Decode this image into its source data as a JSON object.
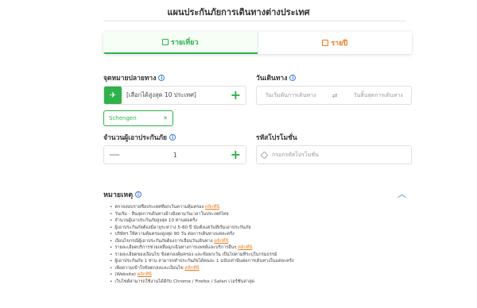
{
  "page": {
    "title": "แผนประกันภัยการเดินทางต่างประเทศ"
  },
  "tabs": [
    {
      "label": "รายเที่ยว"
    },
    {
      "label": "รายปี"
    }
  ],
  "destination": {
    "label": "จุดหมายปลายทาง",
    "placeholder": "[เลือกได้สูงสุด 10 ประเทศ]",
    "chip": "Schengen"
  },
  "travel_dates": {
    "label": "วันเดินทาง",
    "start_placeholder": "วันเริ่มต้นการเดินทาง",
    "end_placeholder": "วันสิ้นสุดการเดินทาง"
  },
  "travelers": {
    "label": "จำนวนผู้เอาประกันภัย",
    "value": "1"
  },
  "promo": {
    "label": "รหัสโปรโมชั่น",
    "placeholder": "กรอกรหัสโปรโมชั่น"
  },
  "remarks": {
    "label": "หมายเหตุ",
    "link_text": "คลิกที่นี่",
    "notes": [
      {
        "text": "ตรวจสอบรายชื่อประเทศที่ยกเว้นความคุ้มครอง ",
        "link": true
      },
      {
        "text": "วันเริ่ม - สิ้นสุดการเดินทางอ้างอิงตามวันเวลาในประเทศไทย",
        "link": false
      },
      {
        "text": "จำนวนผู้เอาประกันภัยสูงสุด 10 ท่านต่อครั้ง",
        "link": false
      },
      {
        "text": "ผู้เอาประกันภัยต้องมีอายุระหว่าง 5-80 ปี นับตั้งแต่วันที่เริ่มเอาประกันภัย",
        "link": false
      },
      {
        "text": "บริษัทฯ ให้ความคุ้มครองสูงสุด 90 วัน ต่อการเดินทางแต่ละครั้ง",
        "link": false
      },
      {
        "text": "เงื่อนไขกรณีผู้เอาประกันภัยต้องการเลื่อนวันเดินทาง ",
        "link": true
      },
      {
        "text": "รายละเอียดบริการช่วยเหลือฉุกเฉินทางการแพทย์และบริการอื่นๆ ",
        "link": true
      },
      {
        "text": "รายละเอียดของเงื่อนไข ข้อตกลงคุ้มครอง และข้อยกเว้น เป็นไปตามที่ระบุในกรมธรรม์",
        "link": false
      },
      {
        "text": "ผู้เอาประกันภัย 1 ท่าน สามารถทำประกันภัยได้คนละ 1 ฉบับเท่านั้นต่อการเดินทางในแต่ละครั้ง",
        "link": false
      },
      {
        "text": "เพื่อความเข้าใจข้อตกลงและเงื่อนไข ",
        "link": true
      },
      {
        "text": "(Website) ",
        "link": true
      },
      {
        "text": "เว็บไซต์สามารถใช้งานได้ดีกับ Chrome / Firefox / Safari เวอร์ชันล่าสุด",
        "link": false
      }
    ]
  }
}
